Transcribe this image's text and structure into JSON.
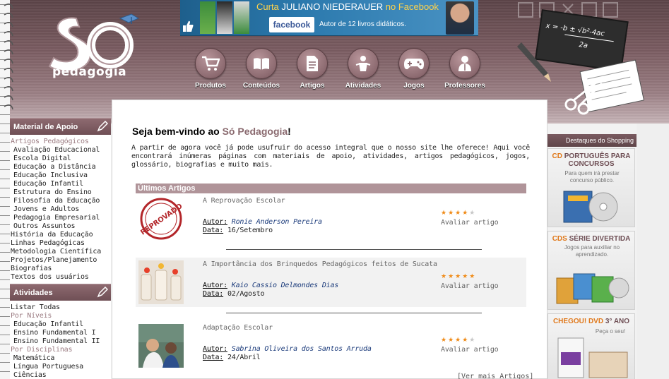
{
  "logo": {
    "text": "pedagogia",
    "mark": "Só"
  },
  "banner": {
    "line1_prefix": "Curta ",
    "line1_name": "JULIANO NIEDERAUER",
    "line1_suffix": " no Facebook",
    "fb_label": "facebook",
    "line2": "Autor de 12 livros didáticos."
  },
  "nav": [
    {
      "label": "Produtos",
      "icon": "cart-icon"
    },
    {
      "label": "Conteúdos",
      "icon": "book-icon"
    },
    {
      "label": "Artigos",
      "icon": "document-icon"
    },
    {
      "label": "Atividades",
      "icon": "activity-icon"
    },
    {
      "label": "Jogos",
      "icon": "gamepad-icon"
    },
    {
      "label": "Professores",
      "icon": "teacher-icon"
    }
  ],
  "sidebar": {
    "material": {
      "title": "Material de Apoio",
      "items": [
        {
          "label": "Artigos Pedagógicos",
          "type": "cat"
        },
        {
          "label": "Avaliação Educacional",
          "type": "sub"
        },
        {
          "label": "Escola Digital",
          "type": "sub"
        },
        {
          "label": "Educação a Distância",
          "type": "sub"
        },
        {
          "label": "Educação Inclusiva",
          "type": "sub"
        },
        {
          "label": "Educação Infantil",
          "type": "sub"
        },
        {
          "label": "Estrutura do Ensino",
          "type": "sub"
        },
        {
          "label": "Filosofia da Educação",
          "type": "sub"
        },
        {
          "label": "Jovens e Adultos",
          "type": "sub"
        },
        {
          "label": "Pedagogia Empresarial",
          "type": "sub"
        },
        {
          "label": "Outros Assuntos",
          "type": "sub"
        },
        {
          "label": "História da Educação",
          "type": "item"
        },
        {
          "label": "Linhas Pedagógicas",
          "type": "item"
        },
        {
          "label": "Metodologia Científica",
          "type": "item"
        },
        {
          "label": "Projetos/Planejamento",
          "type": "item"
        },
        {
          "label": "Biografias",
          "type": "item"
        },
        {
          "label": "Textos dos usuários",
          "type": "item"
        }
      ]
    },
    "atividades": {
      "title": "Atividades",
      "items": [
        {
          "label": "Listar Todas",
          "type": "item"
        },
        {
          "label": "Por Níveis",
          "type": "cat"
        },
        {
          "label": "Educação Infantil",
          "type": "sub"
        },
        {
          "label": "Ensino Fundamental I",
          "type": "sub"
        },
        {
          "label": "Ensino Fundamental II",
          "type": "sub"
        },
        {
          "label": "Por Disciplinas",
          "type": "cat"
        },
        {
          "label": "Matemática",
          "type": "sub"
        },
        {
          "label": "Língua Portuguesa",
          "type": "sub"
        },
        {
          "label": "Ciências",
          "type": "sub"
        }
      ]
    }
  },
  "main": {
    "welcome_prefix": "Seja bem-vindo ao ",
    "welcome_brand": "Só Pedagogia",
    "welcome_suffix": "!",
    "intro": "A partir de agora você já pode usufruir do acesso integral que o nosso site lhe oferece! Aqui você encontrará inúmeras páginas com materiais de apoio, atividades, artigos pedagógicos, jogos, glossário, biografias e muito mais.",
    "articles_title": "Últimos Artigos",
    "author_label": "Autor:",
    "date_label": "Data:",
    "rate_label": "Avaliar artigo",
    "articles": [
      {
        "title": "A Reprovação Escolar",
        "author": "Ronie Anderson Pereira",
        "date": "16/Setembro",
        "rating": 4,
        "thumb_text": "REPROVADO"
      },
      {
        "title": "A Importância dos Brinquedos Pedagógicos feitos de Sucata",
        "author": "Kaio Cassio Delmondes Dias",
        "date": "02/Agosto",
        "rating": 5
      },
      {
        "title": "Adaptação Escolar",
        "author": "Sabrina Oliveira dos Santos Arruda",
        "date": "24/Abril",
        "rating": 4
      }
    ],
    "more_link": "[Ver mais Artigos]"
  },
  "shop": {
    "title": "Destaques do Shopping",
    "items": [
      {
        "title_acc": "CD",
        "title_rest": " PORTUGUÊS PARA CONCURSOS",
        "sub": "Para quem irá prestar concurso público."
      },
      {
        "title_acc": "CDS",
        "title_rest": " SÉRIE DIVERTIDA",
        "sub": "Jogos para auxiliar no aprendizado."
      },
      {
        "title_acc": "CHEGOU! DVD",
        "title_rest": " 3° ANO",
        "sub": "Peça o seu!"
      }
    ]
  },
  "colors": {
    "brand": "#8a6a6f",
    "header": "#6f4f55",
    "star": "#f08c1a",
    "link": "#1a3a7a"
  }
}
